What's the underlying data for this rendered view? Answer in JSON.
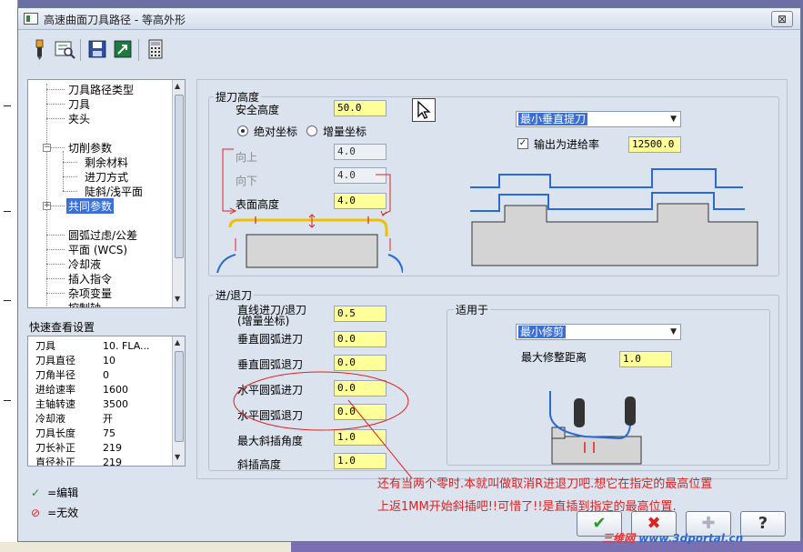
{
  "window": {
    "title": "高速曲面刀具路径 - 等高外形",
    "close_label": "⊠"
  },
  "toolbar": {
    "icons": [
      "tool-icon",
      "view-icon",
      "save-icon",
      "export-icon",
      "calculator-icon"
    ]
  },
  "tree": {
    "items": [
      {
        "label": "刀具路径类型"
      },
      {
        "label": "刀具"
      },
      {
        "label": "夹头"
      },
      {
        "label": "切削参数"
      },
      {
        "label": "剩余材料"
      },
      {
        "label": "进刀方式"
      },
      {
        "label": "陡斜/浅平面"
      },
      {
        "label": "共同参数"
      },
      {
        "label": "圆弧过虑/公差"
      },
      {
        "label": "平面 (WCS)"
      },
      {
        "label": "冷却液"
      },
      {
        "label": "插入指令"
      },
      {
        "label": "杂项变量"
      },
      {
        "label": "控制轴"
      }
    ]
  },
  "quick_view": {
    "title": "快速查看设置",
    "rows": [
      {
        "key": "刀具",
        "value": "10. FLA..."
      },
      {
        "key": "刀具直径",
        "value": "10"
      },
      {
        "key": "刀角半径",
        "value": "0"
      },
      {
        "key": "进给速率",
        "value": "1600"
      },
      {
        "key": "主轴转速",
        "value": "3500"
      },
      {
        "key": "冷却液",
        "value": "开"
      },
      {
        "key": "刀具长度",
        "value": "75"
      },
      {
        "key": "刀长补正",
        "value": "219"
      },
      {
        "key": "直径补正",
        "value": "219"
      }
    ]
  },
  "legend": {
    "edit": "=编辑",
    "invalid": "=无效"
  },
  "retract": {
    "title": "提刀高度",
    "safe_height_label": "安全高度",
    "safe_height": "50.0",
    "abs_label": "绝对坐标",
    "inc_label": "增量坐标",
    "up_label": "向上",
    "up_value": "4.0",
    "down_label": "向下",
    "down_value": "4.0",
    "surface_label": "表面高度",
    "surface_value": "4.0",
    "method_select": "最小垂直提刀",
    "output_feed_label": "输出为进给率",
    "output_feed_value": "12500.0"
  },
  "entry_exit": {
    "title": "进/退刀",
    "line_label_1": "直线进刀/退刀",
    "line_label_2": "(增量坐标)",
    "line_value": "0.5",
    "v_arc_in_label": "垂直圆弧进刀",
    "v_arc_in": "0.0",
    "v_arc_out_label": "垂直圆弧退刀",
    "v_arc_out": "0.0",
    "h_arc_in_label": "水平圆弧进刀",
    "h_arc_in": "0.0",
    "h_arc_out_label": "水平圆弧退刀",
    "h_arc_out": "0.0",
    "max_ramp_label": "最大斜插角度",
    "max_ramp": "1.0",
    "ramp_height_label": "斜插高度",
    "ramp_height": "1.0",
    "apply_title": "适用于",
    "apply_select": "最小修剪",
    "max_trim_label": "最大修整距离",
    "max_trim": "1.0"
  },
  "annotation": {
    "line1": "还有当两个零时.本就叫做取消R进退刀吧.想它在指定的最高位置",
    "line2": "上返1MM开始斜插吧!!可惜了!!是直插到指定的最高位置."
  },
  "buttons": {
    "ok": "✔",
    "cancel": "✖",
    "add": "✚",
    "help": "?"
  },
  "watermark": {
    "brand": "三维网",
    "domain": "www.3dportal.cn"
  },
  "colors": {
    "highlight": "#3a6fd8",
    "field": "#ffff99",
    "annot": "#dd2222"
  }
}
